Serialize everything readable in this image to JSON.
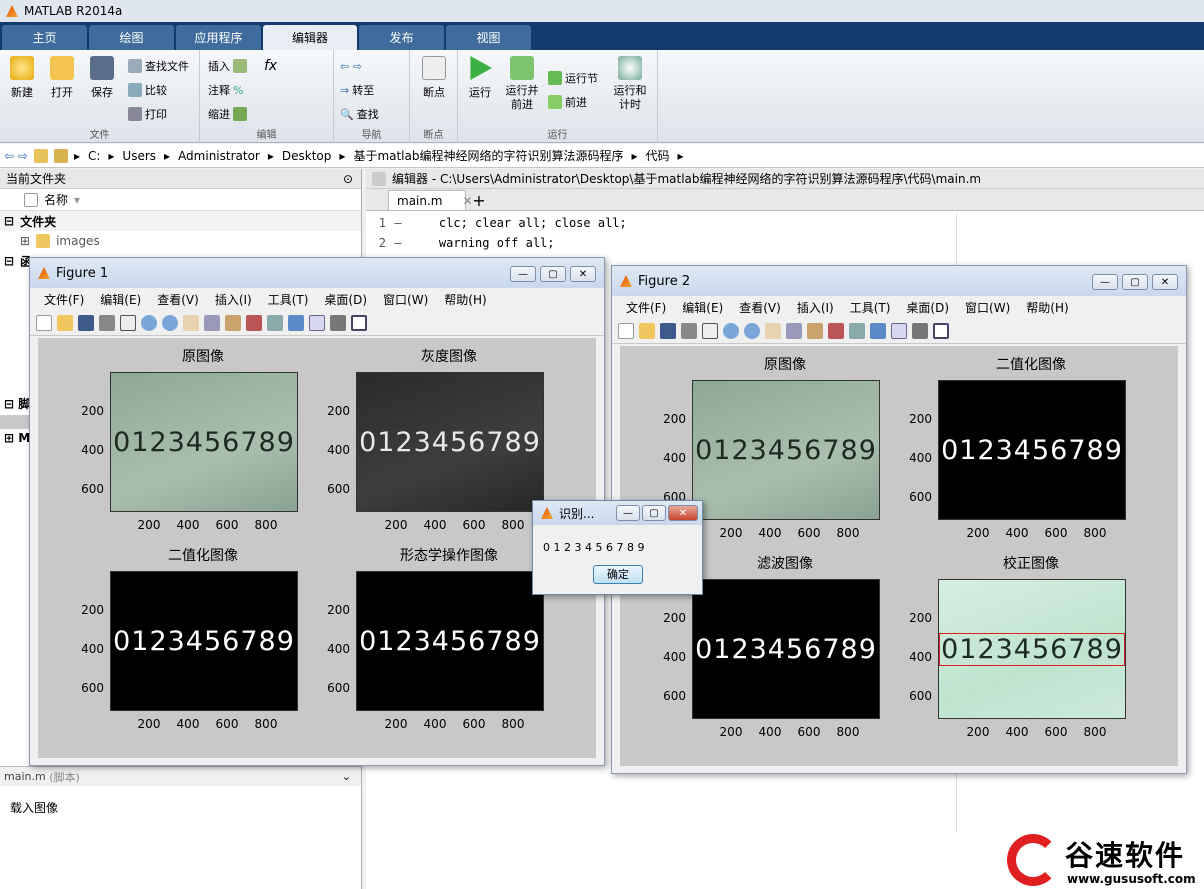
{
  "app": {
    "title": "MATLAB R2014a"
  },
  "tabs": [
    "主页",
    "绘图",
    "应用程序",
    "编辑器",
    "发布",
    "视图"
  ],
  "ribbon": {
    "file": {
      "new": "新建",
      "open": "打开",
      "save": "保存",
      "find_files": "查找文件",
      "compare": "比较",
      "print": "打印",
      "group": "文件"
    },
    "edit": {
      "insert": "插入",
      "comment": "注释",
      "indent": "缩进",
      "group": "编辑",
      "fx": "fx"
    },
    "nav": {
      "goto": "转至",
      "find": "查找",
      "group": "导航"
    },
    "bp": {
      "breakpoints": "断点",
      "group": "断点"
    },
    "run": {
      "run": "运行",
      "run_advance": "运行并\n前进",
      "run_section": "运行节",
      "advance": "前进",
      "run_time": "运行和\n计时",
      "group": "运行"
    }
  },
  "address": {
    "parts": [
      "C:",
      "Users",
      "Administrator",
      "Desktop",
      "基于matlab编程神经网络的字符识别算法源码程序",
      "代码"
    ]
  },
  "left": {
    "header": "当前文件夹",
    "col_name": "名称",
    "folder_section": "文件夹",
    "images": "images",
    "section_fn": "函",
    "section_script": "脚",
    "section_m": "M",
    "details_title": "main.m",
    "details_type": "(脚本)",
    "details_text": "载入图像"
  },
  "editor": {
    "title": "编辑器 - C:\\Users\\Administrator\\Desktop\\基于matlab编程神经网络的字符识别算法源码程序\\代码\\main.m",
    "tab": "main.m",
    "lines": [
      {
        "n": "1",
        "code": "    clc; clear all; close all;"
      },
      {
        "n": "2",
        "code": "    warning off all;"
      }
    ]
  },
  "fig_menu": [
    "文件(F)",
    "编辑(E)",
    "查看(V)",
    "插入(I)",
    "工具(T)",
    "桌面(D)",
    "窗口(W)",
    "帮助(H)"
  ],
  "figure1": {
    "title": "Figure 1",
    "titles": [
      "原图像",
      "灰度图像",
      "二值化图像",
      "形态学操作图像"
    ]
  },
  "figure2": {
    "title": "Figure 2",
    "titles": [
      "原图像",
      "二值化图像",
      "滤波图像",
      "校正图像"
    ]
  },
  "digits": "0123456789",
  "yticks": [
    "200",
    "400",
    "600"
  ],
  "xticks": [
    "200",
    "400",
    "600",
    "800"
  ],
  "dialog": {
    "title": "识别...",
    "text": "0 1 2 3 4 5 6 7 8 9",
    "ok": "确定"
  },
  "brand": {
    "name": "谷速软件",
    "url": "www.gususoft.com"
  }
}
